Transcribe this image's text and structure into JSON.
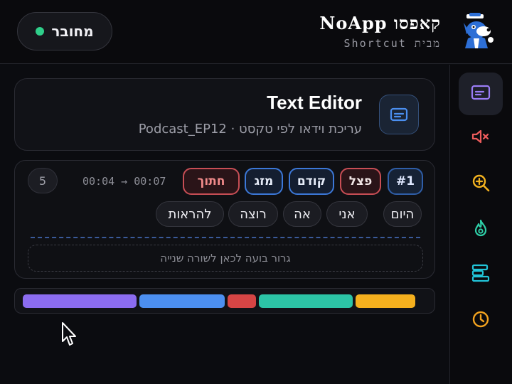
{
  "header": {
    "status_label": "מחובר",
    "brand_logo": "NoApp קאפסו",
    "brand_sub": "מבית Shortcut"
  },
  "rail": {
    "icons": [
      "subtitles-icon",
      "mute-icon",
      "zoom-in-icon",
      "flame-icon",
      "layout-icon",
      "clock-icon"
    ]
  },
  "card": {
    "title": "Text Editor",
    "subtitle": "עריכת וידאו לפי טקסט · Podcast_EP12"
  },
  "segment": {
    "number": "#1",
    "actions": {
      "split": "פצל",
      "previous": "קודם",
      "merge": "מזג",
      "trim": "חתוך"
    },
    "time_start": "00:04",
    "time_end": "00:07",
    "timecode": "00:04 → 00:07",
    "word_count": "5",
    "words": [
      "היום",
      "אני",
      "אה",
      "רוצה",
      "להראות"
    ],
    "drop_hint": "גרור בועה לכאן לשורה שנייה"
  },
  "timeline": {
    "colors": [
      "#8b6cf0",
      "#4c8ff0",
      "#d64545",
      "#2cc4a6",
      "#f5b01e"
    ]
  }
}
